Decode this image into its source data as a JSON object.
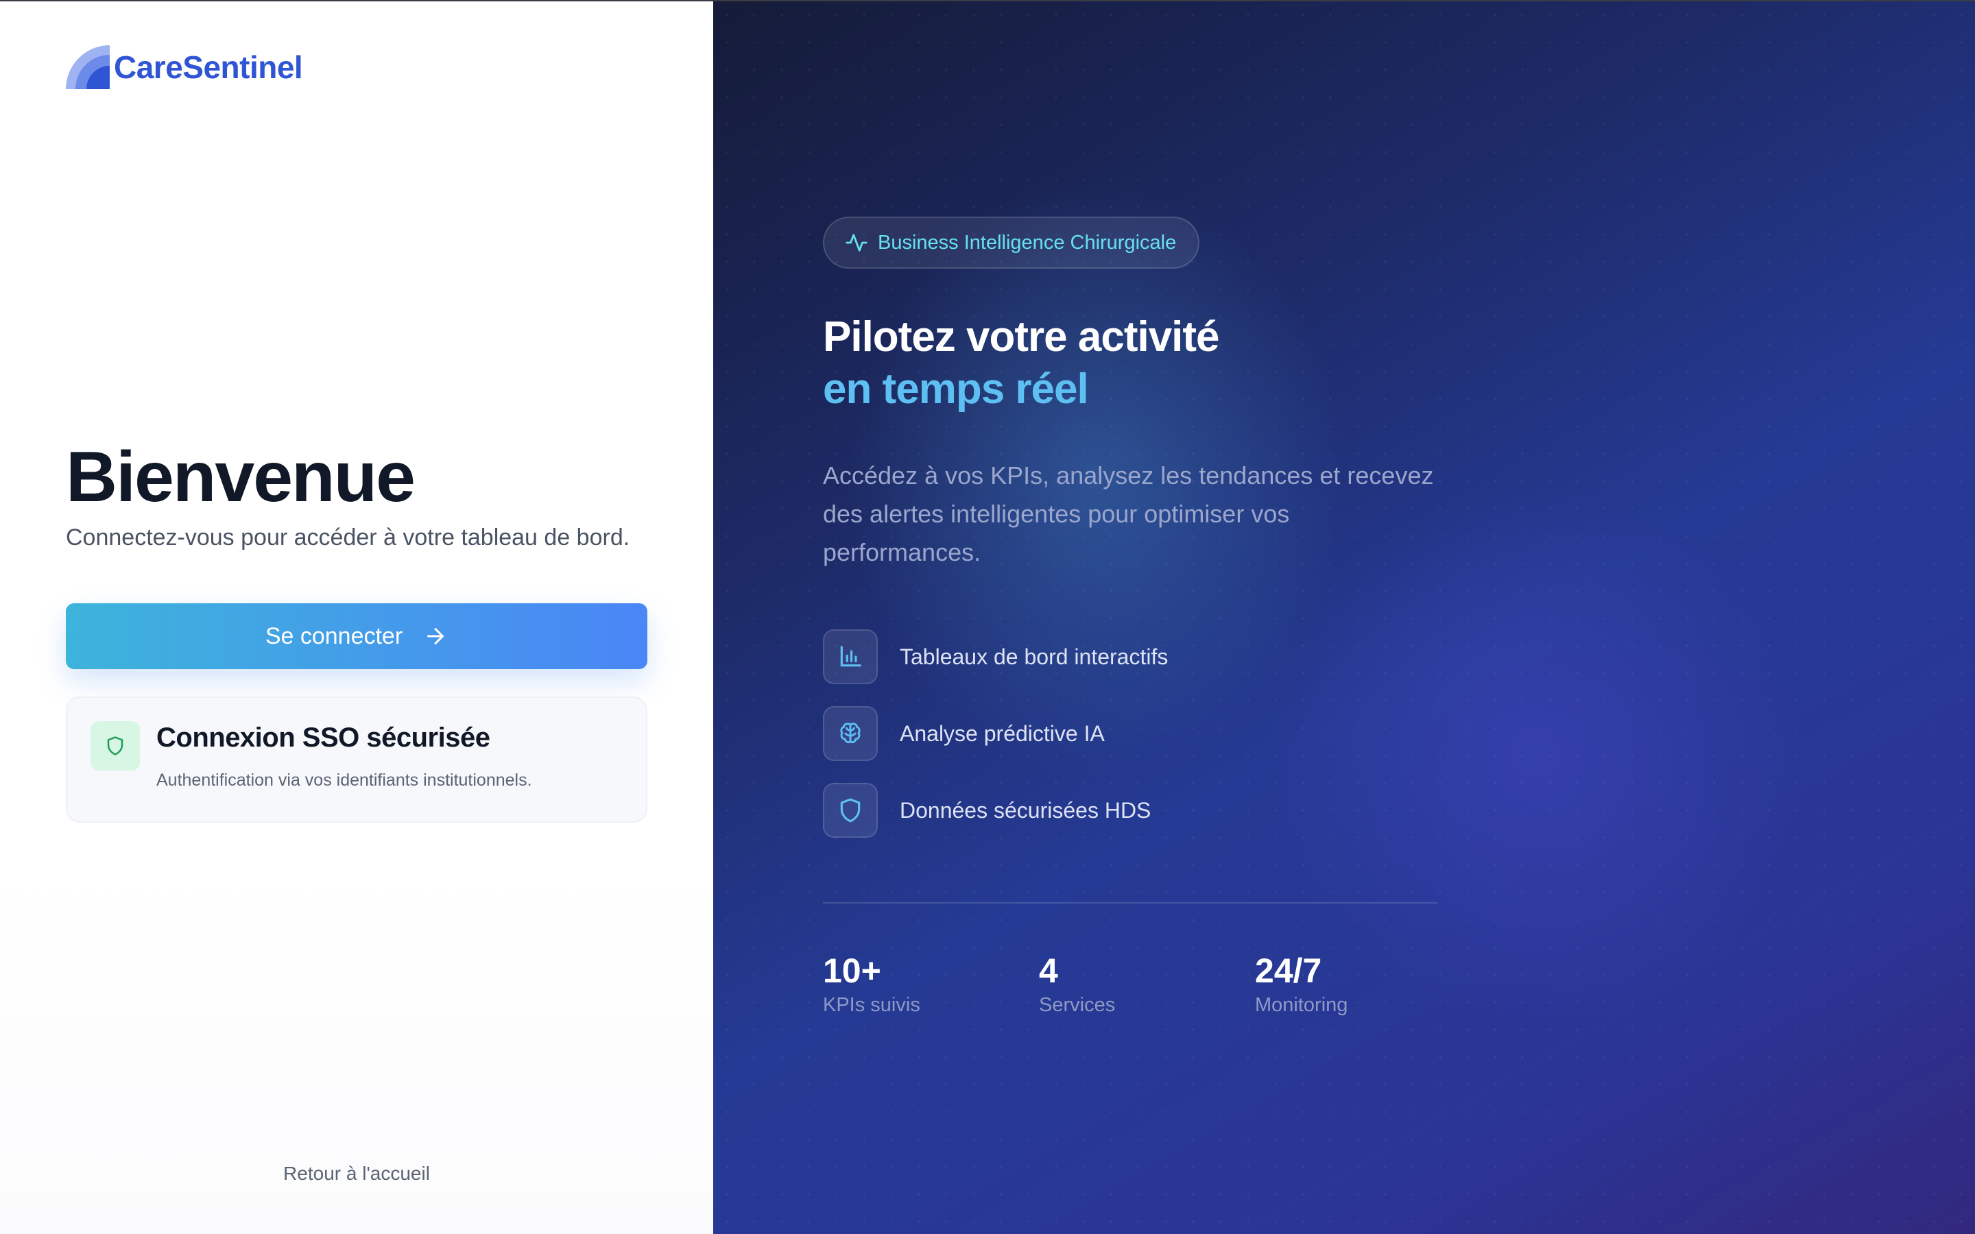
{
  "brand": {
    "name": "CareSentinel",
    "color": "#2f55d4"
  },
  "login": {
    "title": "Bienvenue",
    "subtitle": "Connectez-vous pour accéder à votre tableau de bord.",
    "connect_label": "Se connecter",
    "connect_icon": "arrow-right-icon",
    "sso": {
      "icon": "shield-icon",
      "title": "Connexion SSO sécurisée",
      "description": "Authentification via vos identifiants institutionnels."
    },
    "back_link": "Retour à l'accueil"
  },
  "hero": {
    "badge": {
      "icon": "activity-pulse-icon",
      "label": "Business Intelligence Chirurgicale"
    },
    "headline_line1": "Pilotez votre activité",
    "headline_line2": "en temps réel",
    "description": "Accédez à vos KPIs, analysez les tendances et recevez des alertes intelligentes pour optimiser vos performances.",
    "features": [
      {
        "icon": "bar-chart-icon",
        "label": "Tableaux de bord interactifs"
      },
      {
        "icon": "brain-icon",
        "label": "Analyse prédictive IA"
      },
      {
        "icon": "shield-icon",
        "label": "Données sécurisées HDS"
      }
    ],
    "stats": [
      {
        "value": "10+",
        "label": "KPIs suivis"
      },
      {
        "value": "4",
        "label": "Services"
      },
      {
        "value": "24/7",
        "label": "Monitoring"
      }
    ]
  },
  "colors": {
    "accent_cyan": "#67e0f0",
    "accent_blue": "#5ec0f2",
    "button_gradient_start": "#3db4db",
    "button_gradient_end": "#4a86f6",
    "panel_dark": "#1d2a66"
  }
}
